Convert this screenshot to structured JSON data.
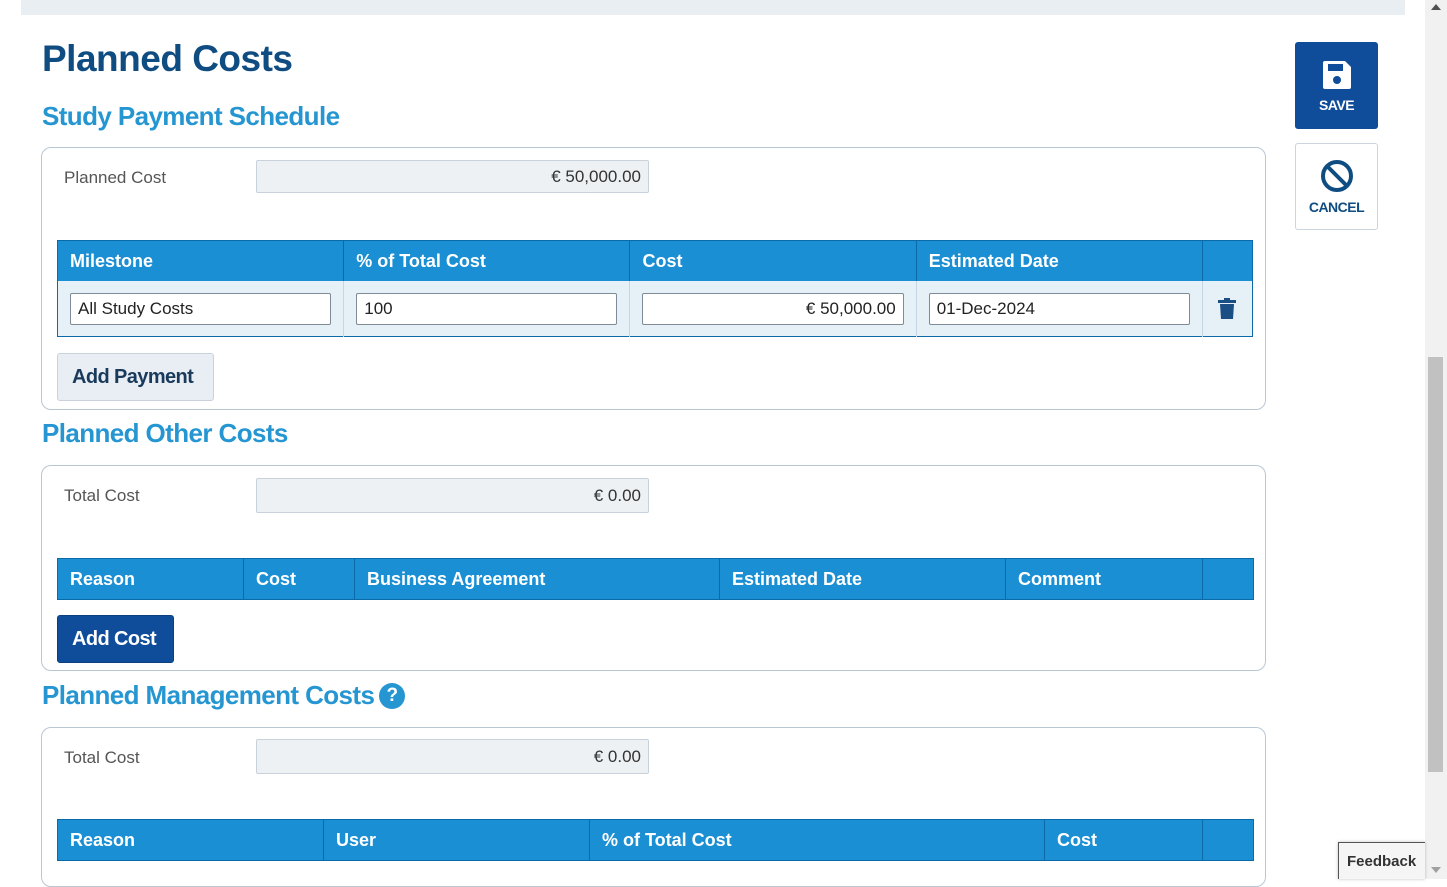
{
  "page": {
    "title": "Planned Costs"
  },
  "actions": {
    "save_label": "SAVE",
    "cancel_label": "CANCEL"
  },
  "payment_schedule": {
    "title": "Study Payment Schedule",
    "planned_cost_label": "Planned Cost",
    "planned_cost_value": "€ 50,000.00",
    "columns": [
      "Milestone",
      "% of Total Cost",
      "Cost",
      "Estimated Date"
    ],
    "rows": [
      {
        "milestone": "All Study Costs",
        "percent": "100",
        "cost": "€ 50,000.00",
        "date": "01-Dec-2024"
      }
    ],
    "add_label": "Add Payment"
  },
  "other_costs": {
    "title": "Planned Other Costs",
    "total_label": "Total Cost",
    "total_value": "€ 0.00",
    "columns": [
      "Reason",
      "Cost",
      "Business Agreement",
      "Estimated Date",
      "Comment"
    ],
    "add_label": "Add Cost"
  },
  "management_costs": {
    "title": "Planned Management Costs",
    "help_glyph": "?",
    "total_label": "Total Cost",
    "total_value": "€ 0.00",
    "columns": [
      "Reason",
      "User",
      "% of Total Cost",
      "Cost"
    ]
  },
  "feedback_label": "Feedback",
  "colors": {
    "primary_dark": "#0f4c9a",
    "header_blue": "#1b8fd3",
    "section_blue": "#2596d1",
    "title_navy": "#0f4c81"
  },
  "icons": {
    "save": "floppy-disk-icon",
    "cancel": "prohibited-icon",
    "delete": "trash-icon",
    "help": "question-icon"
  }
}
